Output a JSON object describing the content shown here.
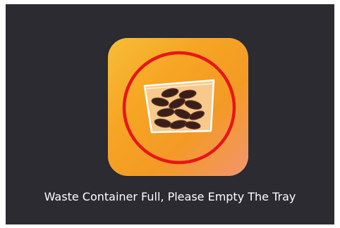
{
  "screen": {
    "icon": "waste-container-full-icon",
    "message": "Waste Container Full, Please Empty The Tray"
  },
  "colors": {
    "background": "#2b2b31",
    "tile_gradient_start": "#f7bd38",
    "tile_gradient_end": "#f2956e",
    "alert_ring": "#e8151b",
    "puck": "#3a1e1a",
    "text": "#ffffff"
  }
}
